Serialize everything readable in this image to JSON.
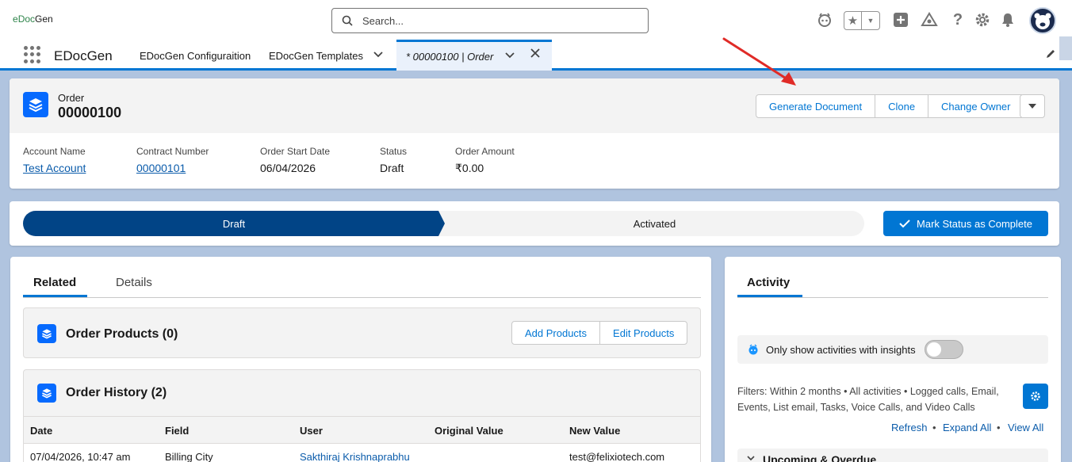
{
  "header": {
    "logo_text_a": "e",
    "logo_text_b": "Doc",
    "logo_text_c": "Gen",
    "search_placeholder": "Search..."
  },
  "nav": {
    "app_name": "EDocGen",
    "items": [
      {
        "label": "EDocGen Configuraition"
      },
      {
        "label": "EDocGen Templates"
      }
    ],
    "active_tab": "* 00000100 | Order"
  },
  "record": {
    "object_type": "Order",
    "name": "00000100",
    "actions": {
      "generate": "Generate Document",
      "clone": "Clone",
      "change_owner": "Change Owner"
    },
    "fields": [
      {
        "label": "Account Name",
        "value": "Test Account"
      },
      {
        "label": "Contract Number",
        "value": "00000101"
      },
      {
        "label": "Order Start Date",
        "value": "06/04/2026"
      },
      {
        "label": "Status",
        "value": "Draft"
      },
      {
        "label": "Order Amount",
        "value": "₹0.00"
      }
    ]
  },
  "path": {
    "stages": [
      "Draft",
      "Activated"
    ],
    "mark_button": "Mark Status as Complete"
  },
  "related": {
    "tabs": [
      "Related",
      "Details"
    ],
    "order_products": {
      "title": "Order Products (0)",
      "add": "Add Products",
      "edit": "Edit Products"
    },
    "order_history": {
      "title": "Order History (2)",
      "columns": [
        "Date",
        "Field",
        "User",
        "Original Value",
        "New Value"
      ],
      "rows": [
        [
          "07/04/2026, 10:47 am",
          "Billing City",
          "Sakthiraj Krishnaprabhu",
          "",
          "test@felixiotech.com"
        ]
      ]
    }
  },
  "activity": {
    "tab": "Activity",
    "insights_label": "Only show activities with insights",
    "insights_toggle": false,
    "filters_text": "Filters: Within 2 months • All activities • Logged calls, Email, Events, List email, Tasks, Voice Calls, and Video Calls",
    "links": [
      "Refresh",
      "Expand All",
      "View All"
    ],
    "upcoming_label": "Upcoming & Overdue"
  },
  "colors": {
    "brand": "#0176d3",
    "path_active": "#014486",
    "annotation_arrow": "#e02b27"
  }
}
